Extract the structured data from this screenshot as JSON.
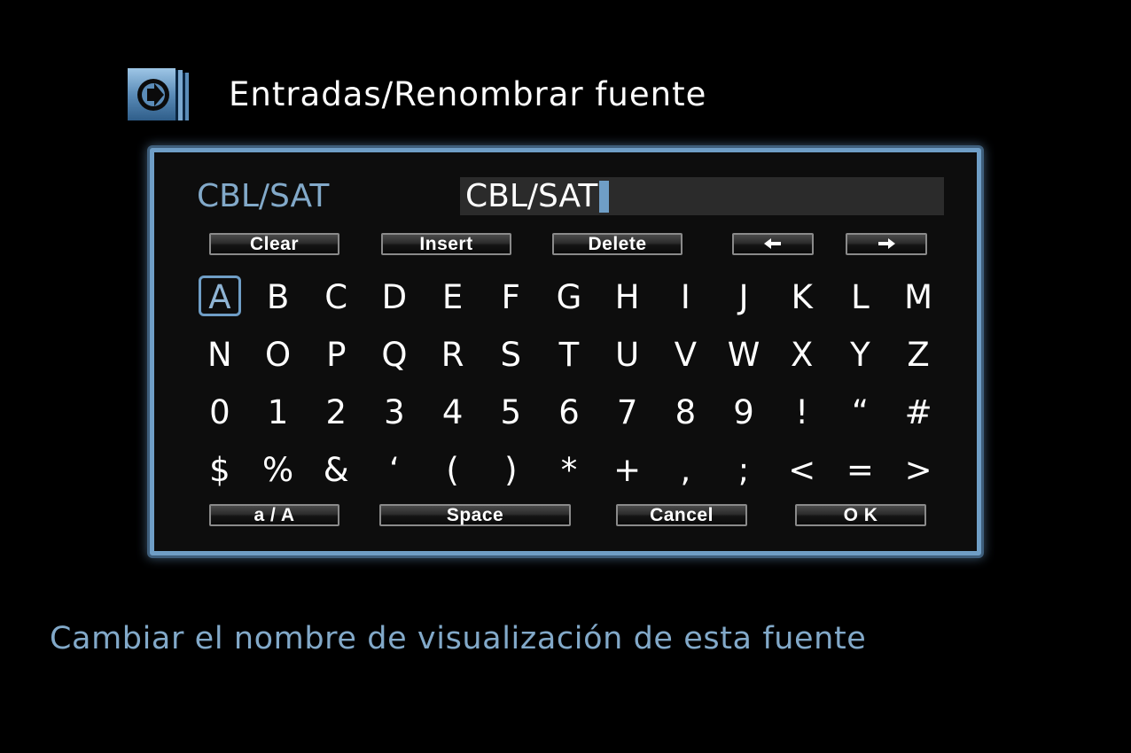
{
  "header": {
    "icon": "input-arrow-icon",
    "title": "Entradas/Renombrar fuente"
  },
  "dialog": {
    "source_name": "CBL/SAT",
    "input_value": "CBL/SAT",
    "controls": {
      "clear": "Clear",
      "insert": "Insert",
      "delete": "Delete",
      "left_icon": "arrow-left-icon",
      "right_icon": "arrow-right-icon"
    },
    "selected_key": "A",
    "keys": [
      "A",
      "B",
      "C",
      "D",
      "E",
      "F",
      "G",
      "H",
      "I",
      "J",
      "K",
      "L",
      "M",
      "N",
      "O",
      "P",
      "Q",
      "R",
      "S",
      "T",
      "U",
      "V",
      "W",
      "X",
      "Y",
      "Z",
      "0",
      "1",
      "2",
      "3",
      "4",
      "5",
      "6",
      "7",
      "8",
      "9",
      "!",
      "“",
      "#",
      "$",
      "%",
      "&",
      "‘",
      "(",
      ")",
      "*",
      "+",
      ",",
      ";",
      "<",
      "=",
      ">"
    ],
    "bottom": {
      "case_toggle": "a / A",
      "space": "Space",
      "cancel": "Cancel",
      "ok": "O K"
    }
  },
  "help_text": "Cambiar el nombre de visualización de esta fuente",
  "colors": {
    "accent": "#6f9ec6",
    "label_text": "#82a9c9",
    "background": "#000000"
  }
}
